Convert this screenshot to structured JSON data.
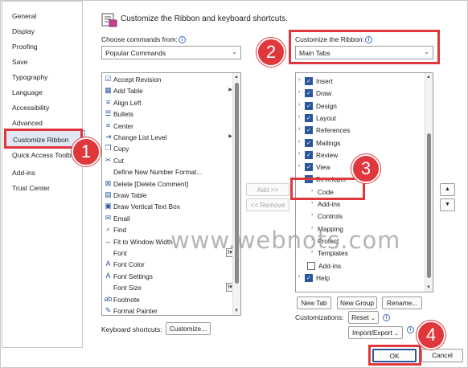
{
  "nav": {
    "items": [
      {
        "label": "General"
      },
      {
        "label": "Display"
      },
      {
        "label": "Proofing"
      },
      {
        "label": "Save"
      },
      {
        "label": "Typography"
      },
      {
        "label": "Language"
      },
      {
        "label": "Accessibility"
      },
      {
        "label": "Advanced"
      },
      {
        "label": "Customize Ribbon"
      },
      {
        "label": "Quick Access Toolbar"
      },
      {
        "label": "Add-ins"
      },
      {
        "label": "Trust Center"
      }
    ]
  },
  "header": {
    "title": "Customize the Ribbon and keyboard shortcuts."
  },
  "choose": {
    "label": "Choose commands from:",
    "value": "Popular Commands"
  },
  "customize": {
    "label": "Customize the Ribbon:",
    "value": "Main Tabs"
  },
  "commands": [
    {
      "icon": "accept-revision-icon",
      "glyph": "☑",
      "label": "Accept Revision"
    },
    {
      "icon": "add-table-icon",
      "glyph": "▦",
      "label": "Add Table"
    },
    {
      "icon": "align-left-icon",
      "glyph": "≡",
      "label": "Align Left"
    },
    {
      "icon": "bullets-icon",
      "glyph": "☰",
      "label": "Bullets"
    },
    {
      "icon": "center-icon",
      "glyph": "≡",
      "label": "Center"
    },
    {
      "icon": "change-list-level-icon",
      "glyph": "⇥",
      "label": "Change List Level"
    },
    {
      "icon": "copy-icon",
      "glyph": "❐",
      "label": "Copy"
    },
    {
      "icon": "cut-icon",
      "glyph": "✂",
      "label": "Cut"
    },
    {
      "icon": "",
      "glyph": "",
      "label": "Define New Number Format..."
    },
    {
      "icon": "delete-comment-icon",
      "glyph": "⊠",
      "label": "Delete [Delete Comment]"
    },
    {
      "icon": "draw-table-icon",
      "glyph": "▤",
      "label": "Draw Table"
    },
    {
      "icon": "draw-vertical-text-box-icon",
      "glyph": "▣",
      "label": "Draw Vertical Text Box"
    },
    {
      "icon": "email-icon",
      "glyph": "✉",
      "label": "Email"
    },
    {
      "icon": "find-icon",
      "glyph": "⌕",
      "label": "Find"
    },
    {
      "icon": "fit-to-window-width-icon",
      "glyph": "↔",
      "label": "Fit to Window Width"
    },
    {
      "icon": "",
      "glyph": "",
      "label": "Font"
    },
    {
      "icon": "font-color-icon",
      "glyph": "A",
      "label": "Font Color"
    },
    {
      "icon": "font-settings-icon",
      "glyph": "A",
      "label": "Font Settings"
    },
    {
      "icon": "",
      "glyph": "",
      "label": "Font Size"
    },
    {
      "icon": "footnote-icon",
      "glyph": "ab",
      "label": "Footnote"
    },
    {
      "icon": "format-painter-icon",
      "glyph": "✎",
      "label": "Format Painter"
    }
  ],
  "tabs": [
    {
      "label": "Insert",
      "checked": true
    },
    {
      "label": "Draw",
      "checked": true
    },
    {
      "label": "Design",
      "checked": true
    },
    {
      "label": "Layout",
      "checked": true
    },
    {
      "label": "References",
      "checked": true
    },
    {
      "label": "Mailings",
      "checked": true
    },
    {
      "label": "Review",
      "checked": true
    },
    {
      "label": "View",
      "checked": true
    },
    {
      "label": "Developer",
      "checked": true
    },
    {
      "label": "Code",
      "checked": false
    },
    {
      "label": "Add-ins",
      "checked": false
    },
    {
      "label": "Controls",
      "checked": false
    },
    {
      "label": "Mapping",
      "checked": false
    },
    {
      "label": "Protect",
      "checked": false
    },
    {
      "label": "Templates",
      "checked": false
    },
    {
      "label": "Add-ins",
      "checked": false
    },
    {
      "label": "Help",
      "checked": true
    }
  ],
  "buttons": {
    "add": "Add >>",
    "remove": "<< Remove",
    "new_tab": "New Tab",
    "new_group": "New Group",
    "rename": "Rename...",
    "reset": "Reset",
    "import_export": "Import/Export",
    "customize": "Customize...",
    "ok": "OK",
    "cancel": "Cancel",
    "move_up": "▲",
    "move_down": "▼"
  },
  "keyboard": {
    "label": "Keyboard shortcuts:"
  },
  "customizations": {
    "label": "Customizations:"
  },
  "callouts": [
    "1",
    "2",
    "3",
    "4"
  ],
  "watermark": "www.webnots.com",
  "colors": {
    "accent": "#2b579a",
    "callout": "#e0373d"
  }
}
